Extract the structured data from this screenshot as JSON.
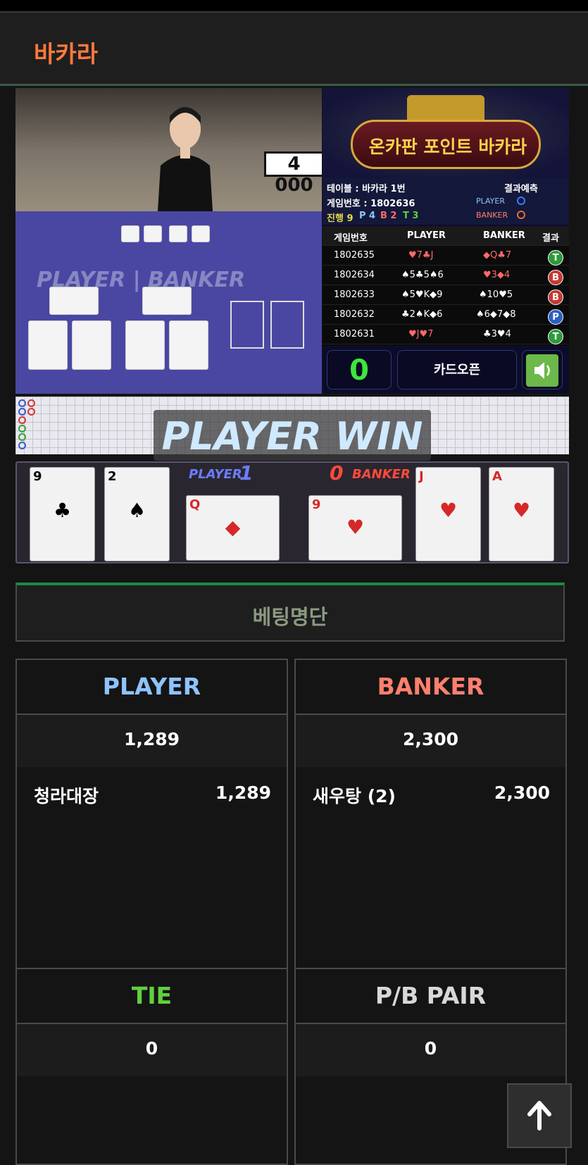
{
  "header": {
    "title": "바카라"
  },
  "video": {
    "sign_text": "4 000",
    "table_label": "PLAYER | BANKER"
  },
  "info": {
    "banner_text": "온카판 포인트 바카라",
    "table_line": "테이블 : 바카라 1번",
    "game_line": "게임번호 : 1802636",
    "progress_label": "진행 9",
    "progress_p": "P 4",
    "progress_b": "B 2",
    "progress_t": "T 3",
    "predict_label": "결과예측",
    "predict_player": "PLAYER",
    "predict_banker": "BANKER"
  },
  "results": {
    "headers": [
      "게임번호",
      "PLAYER",
      "BANKER",
      "결과"
    ],
    "rows": [
      {
        "game": "1802635",
        "player": "♥7♣J",
        "banker": "◆Q♣7",
        "result": "T"
      },
      {
        "game": "1802634",
        "player": "♠5♣5♠6",
        "banker": "♥3◆4",
        "result": "B"
      },
      {
        "game": "1802633",
        "player": "♠5♥K◆9",
        "banker": "♠10♥5",
        "result": "B"
      },
      {
        "game": "1802632",
        "player": "♣2♠K◆6",
        "banker": "♠6◆7◆8",
        "result": "P"
      },
      {
        "game": "1802631",
        "player": "♥J♥7",
        "banker": "♣3♥4",
        "result": "T"
      }
    ]
  },
  "controls": {
    "count": "0",
    "open_label": "카드오픈",
    "sound_icon": "speaker-icon"
  },
  "win_banner": "PLAYER WIN",
  "cards": {
    "player_label": "PLAYER",
    "player_score": "1",
    "banker_label": "BANKER",
    "banker_score": "0",
    "player_cards": [
      {
        "rank": "9",
        "suit": "♣"
      },
      {
        "rank": "2",
        "suit": "♠"
      },
      {
        "rank": "Q",
        "suit": "◆"
      }
    ],
    "banker_cards": [
      {
        "rank": "9",
        "suit": "♥"
      },
      {
        "rank": "J",
        "suit": "♥"
      },
      {
        "rank": "A",
        "suit": "♥"
      }
    ]
  },
  "betting": {
    "title": "베팅명단",
    "player": {
      "label": "PLAYER",
      "total": "1,289",
      "entries": [
        {
          "name": "청라대장",
          "amount": "1,289"
        }
      ]
    },
    "banker": {
      "label": "BANKER",
      "total": "2,300",
      "entries": [
        {
          "name": "새우탕 (2)",
          "amount": "2,300"
        }
      ]
    },
    "tie": {
      "label": "TIE",
      "total": "0"
    },
    "pair": {
      "label": "P/B PAIR",
      "total": "0"
    }
  },
  "colors": {
    "accent": "#ff7a3d",
    "player": "#8ec3ff",
    "banker": "#ff7f6e",
    "tie": "#5fd13e",
    "count": "#3ee63e"
  },
  "scroll_top_icon": "arrow-up-icon"
}
